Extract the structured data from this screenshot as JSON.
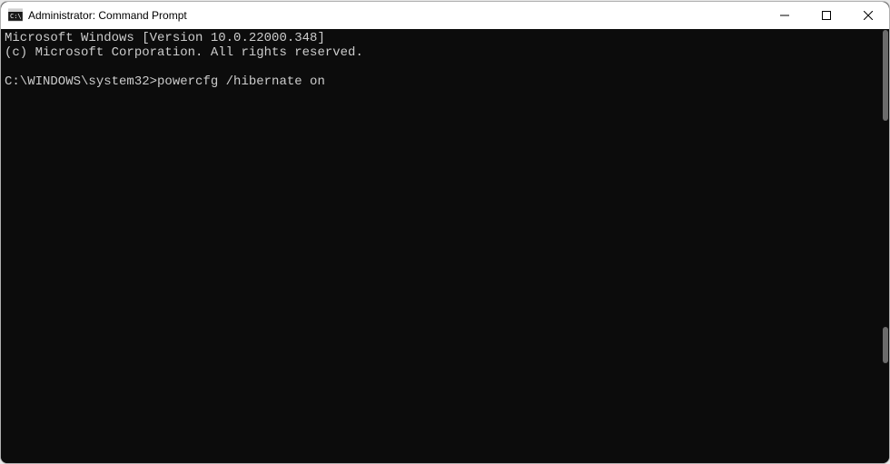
{
  "window": {
    "title": "Administrator: Command Prompt"
  },
  "terminal": {
    "line1": "Microsoft Windows [Version 10.0.22000.348]",
    "line2": "(c) Microsoft Corporation. All rights reserved.",
    "blank": "",
    "prompt": "C:\\WINDOWS\\system32>",
    "command": "powercfg /hibernate on"
  }
}
